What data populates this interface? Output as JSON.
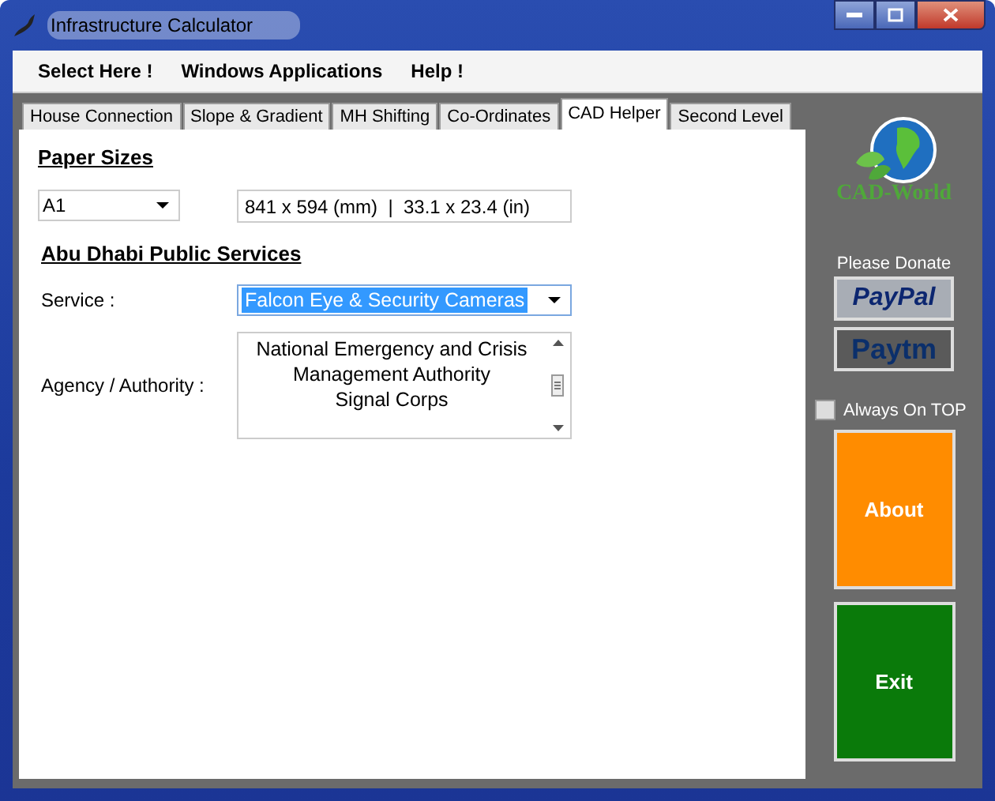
{
  "window": {
    "title": "Infrastructure Calculator"
  },
  "menu": [
    "Select Here !",
    "Windows Applications",
    "Help !"
  ],
  "tabs": [
    {
      "label": "House Connection",
      "selected": false
    },
    {
      "label": "Slope & Gradient",
      "selected": false
    },
    {
      "label": "MH Shifting",
      "selected": false
    },
    {
      "label": "Co-Ordinates",
      "selected": false
    },
    {
      "label": "CAD Helper",
      "selected": true
    },
    {
      "label": "Second Level",
      "selected": false
    }
  ],
  "paper_sizes": {
    "heading": "Paper Sizes",
    "size": "A1",
    "dimensions": "841 x 594 (mm)  |  33.1 x 23.4 (in)"
  },
  "public_services": {
    "heading": "Abu Dhabi Public Services",
    "service_label": "Service :",
    "service": "Falcon Eye & Security Cameras",
    "agency_label": "Agency / Authority :",
    "agency_lines": [
      "National Emergency and Crisis",
      "Management Authority",
      "Signal Corps"
    ]
  },
  "sidebar": {
    "logo": "CAD-World",
    "donate": "Please Donate",
    "paypal": "PayPal",
    "paytm": "Paytm",
    "always_on_top": {
      "label": "Always On TOP",
      "checked": false
    },
    "about": "About",
    "exit": "Exit"
  }
}
